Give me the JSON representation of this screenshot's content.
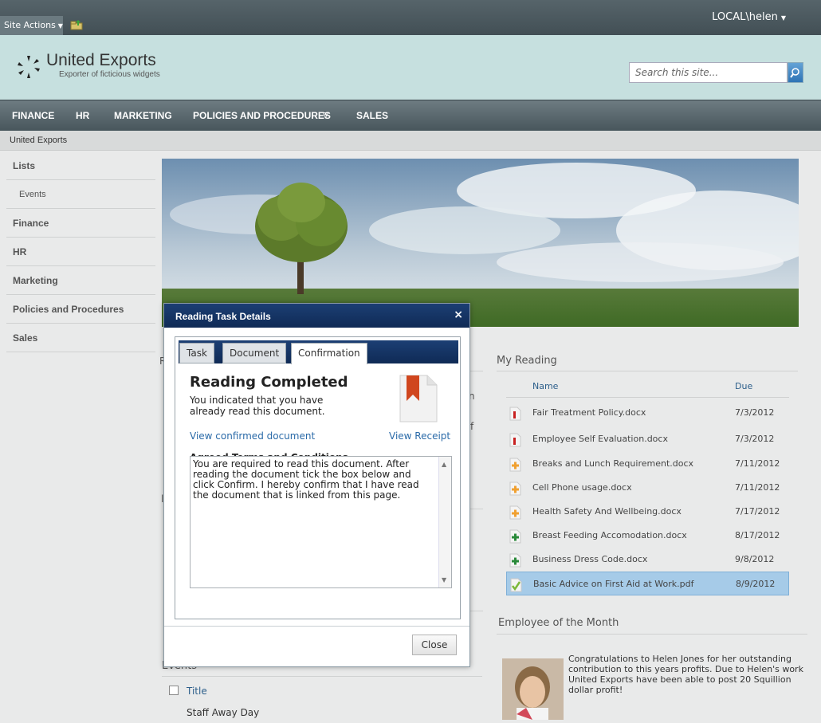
{
  "topbar": {
    "site_actions": "Site Actions",
    "user": "LOCAL\\helen"
  },
  "brand": {
    "title": "United Exports",
    "subtitle": "Exporter of ficticious widgets"
  },
  "search": {
    "placeholder": "Search this site..."
  },
  "topnav": [
    {
      "label": "FINANCE"
    },
    {
      "label": "HR"
    },
    {
      "label": "MARKETING"
    },
    {
      "label": "POLICIES AND PROCEDURES"
    },
    {
      "label": "SALES"
    }
  ],
  "breadcrumb": "United Exports",
  "leftnav": [
    {
      "label": "Lists"
    },
    {
      "label": "Events"
    },
    {
      "label": "Finance"
    },
    {
      "label": "HR"
    },
    {
      "label": "Marketing"
    },
    {
      "label": "Policies and Procedures"
    },
    {
      "label": "Sales"
    }
  ],
  "my_reading": {
    "title": "My Reading",
    "col_name": "Name",
    "col_due": "Due",
    "rows": [
      {
        "name": "Fair Treatment Policy.docx",
        "due": "7/3/2012",
        "status": "overdue"
      },
      {
        "name": "Employee Self Evaluation.docx",
        "due": "7/3/2012",
        "status": "overdue"
      },
      {
        "name": "Breaks and Lunch Requirement.docx",
        "due": "7/11/2012",
        "status": "pending"
      },
      {
        "name": "Cell Phone usage.docx",
        "due": "7/11/2012",
        "status": "pending"
      },
      {
        "name": "Health Safety And Wellbeing.docx",
        "due": "7/17/2012",
        "status": "pending"
      },
      {
        "name": "Breast Feeding Accomodation.docx",
        "due": "8/17/2012",
        "status": "new"
      },
      {
        "name": "Business Dress Code.docx",
        "due": "9/8/2012",
        "status": "new"
      },
      {
        "name": "Basic Advice on First Aid at Work.pdf",
        "due": "8/9/2012",
        "status": "completed"
      }
    ]
  },
  "employee_of_month": {
    "title": "Employee of the Month",
    "text": "Congratulations to Helen Jones for her outstanding contribution to this years profits. Due to Helen's work United Exports have been able to post 20 Squillion dollar profit!"
  },
  "events": {
    "title": "Events",
    "col_title": "Title",
    "rows": [
      "Staff Away Day"
    ]
  },
  "dialog": {
    "title": "Reading Task Details",
    "close_x": "×",
    "tabs": [
      "Task",
      "Document",
      "Confirmation"
    ],
    "heading": "Reading Completed",
    "description": "You indicated that you have already read this document.",
    "view_confirmed": "View confirmed document",
    "view_receipt": "View Receipt",
    "terms_label": "Agreed Terms and Conditions",
    "terms_text": "You are required to read this document. After reading the document tick the box below and click Confirm. I hereby confirm that I have read the document that is linked from this page.",
    "close_button": "Close"
  }
}
